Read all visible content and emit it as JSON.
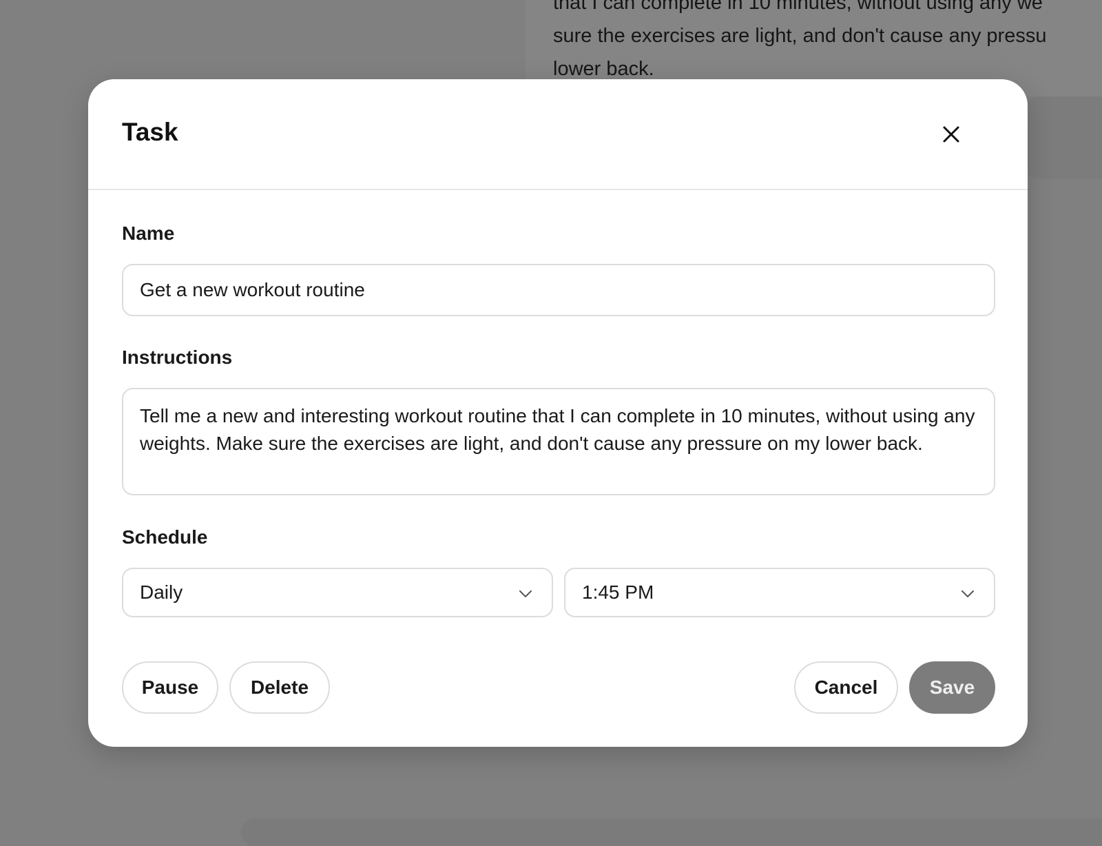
{
  "background": {
    "message_text": "that I can complete in 10 minutes, without using any we\nsure the exercises are light, and don't cause any pressu\nlower back."
  },
  "modal": {
    "title": "Task",
    "close_icon": "close-icon",
    "name": {
      "label": "Name",
      "value": "Get a new workout routine"
    },
    "instructions": {
      "label": "Instructions",
      "value": "Tell me a new and interesting workout routine that I can complete in 10 minutes, without using any weights. Make sure the exercises are light, and don't cause any pressure on my lower back."
    },
    "schedule": {
      "label": "Schedule",
      "frequency": "Daily",
      "time": "1:45 PM",
      "dropdown_icon": "chevron-down-icon"
    },
    "buttons": {
      "pause": "Pause",
      "delete": "Delete",
      "cancel": "Cancel",
      "save": "Save"
    }
  },
  "colors": {
    "overlay": "#808080",
    "modal_bg": "#ffffff",
    "save_disabled": "#7c7c7c",
    "border": "#dcdcdc"
  }
}
